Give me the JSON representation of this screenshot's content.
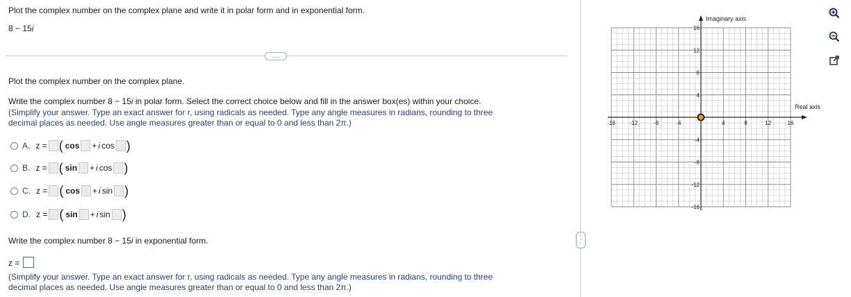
{
  "question": {
    "prompt": "Plot the complex number on the complex plane and write it in polar form and in exponential form.",
    "number_label": "8 − 15",
    "number_i": "i"
  },
  "more_button": "....",
  "part1": {
    "instruction": "Plot the complex number on the complex plane."
  },
  "part2": {
    "instruction_pre": "Write the complex number 8 − 15",
    "instruction_i": "i",
    "instruction_post": " in polar form. Select the correct choice below and fill in the answer box(es) within your choice.",
    "hint_line1": "(Simplify your answer. Type an exact answer for r, using radicals as needed. Type any angle measures in radians, rounding to three",
    "hint_line2": "decimal places as needed. Use angle measures greater than or equal to 0 and less than 2π.)",
    "choices": [
      {
        "letter": "A.",
        "z": "z =",
        "f1": "cos",
        "plus": "+",
        "i": "i",
        "f2": "cos"
      },
      {
        "letter": "B.",
        "z": "z =",
        "f1": "sin",
        "plus": "+",
        "i": "i",
        "f2": "cos"
      },
      {
        "letter": "C.",
        "z": "z =",
        "f1": "cos",
        "plus": "+",
        "i": "i",
        "f2": "sin"
      },
      {
        "letter": "D.",
        "z": "z =",
        "f1": "sin",
        "plus": "+",
        "i": "i",
        "f2": "sin"
      }
    ]
  },
  "part3": {
    "instruction_pre": "Write the complex number 8 − 15",
    "instruction_i": "i",
    "instruction_post": " in exponential form.",
    "z": "z =",
    "hint_line1": "(Simplify your answer. Type an exact answer for r, using radicals as needed. Type any angle measures in radians, rounding to three",
    "hint_line2": "decimal places as needed. Use angle measures greater than or equal to 0 and less than 2π.)"
  },
  "graph": {
    "x_axis_label": "Real axis",
    "y_axis_label": "Imaginary axis",
    "x_ticks": [
      "-16",
      "-12",
      "-8",
      "-4",
      "4",
      "8",
      "12",
      "16"
    ],
    "y_ticks": [
      "16",
      "12",
      "8",
      "4",
      "-4",
      "-8",
      "-12",
      "-16"
    ],
    "point": {
      "x": 0,
      "y": 0
    },
    "range": [
      -16,
      16
    ],
    "point_color": "#e89b2a"
  },
  "tools": [
    "zoom-in-icon",
    "zoom-out-icon",
    "popout-icon"
  ]
}
